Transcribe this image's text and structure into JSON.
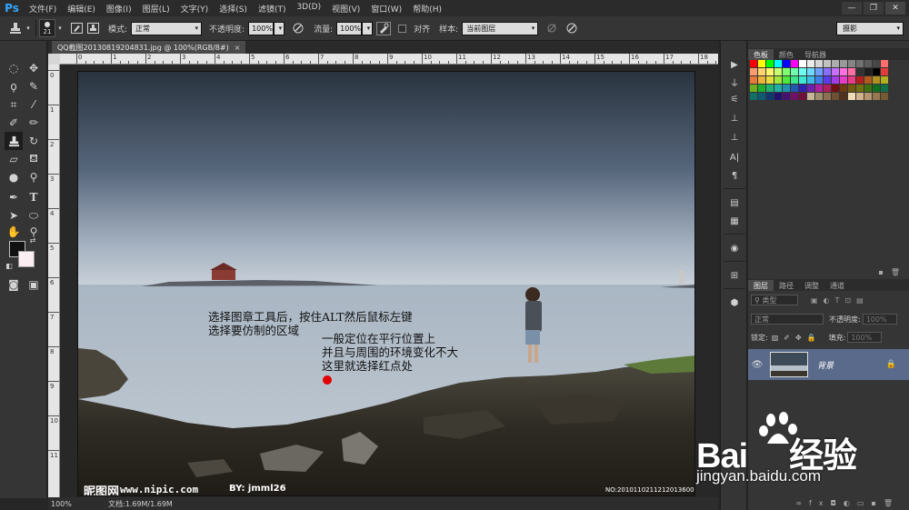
{
  "app": {
    "logo": "Ps"
  },
  "menu": [
    "文件(F)",
    "编辑(E)",
    "图像(I)",
    "图层(L)",
    "文字(Y)",
    "选择(S)",
    "滤镜(T)",
    "3D(D)",
    "视图(V)",
    "窗口(W)",
    "帮助(H)"
  ],
  "window_controls": {
    "minimize": "—",
    "restore": "❐",
    "close": "✕"
  },
  "options": {
    "brush_size": "21",
    "mode_label": "模式:",
    "mode_value": "正常",
    "opacity_label": "不透明度:",
    "opacity_value": "100%",
    "flow_label": "流量:",
    "flow_value": "100%",
    "align_label": "对齐",
    "sample_label": "样本:",
    "sample_value": "当前图层"
  },
  "workspace": {
    "value": "摄影"
  },
  "document": {
    "tab_title": "QQ截图20130819204831.jpg @ 100%(RGB/8#)",
    "tab_close": "×"
  },
  "rulers": {
    "top": [
      "0",
      "1",
      "2",
      "3",
      "4",
      "5",
      "6",
      "7",
      "8",
      "9",
      "10",
      "11",
      "12",
      "13",
      "14",
      "15",
      "16",
      "17",
      "18"
    ],
    "left": [
      "0",
      "1",
      "2",
      "3",
      "4",
      "5",
      "6",
      "7",
      "8",
      "9",
      "10",
      "11"
    ]
  },
  "canvas": {
    "note1_line1": "选择图章工具后，按住ALT然后鼠标左键",
    "note1_line2": "选择要仿制的区域",
    "note2_line1": "一般定位在平行位置上",
    "note2_line2": "并且与周围的环境变化不大",
    "note2_line3": "这里就选择红点处",
    "watermark_brand": "昵图网",
    "watermark_url": "www.nipic.com",
    "watermark_author": "BY: jmml26",
    "watermark_no": "NO:20101102112120136000",
    "dot_color": "#e00000"
  },
  "status": {
    "zoom": "100%",
    "doc_info": "文档:1.69M/1.69M"
  },
  "panels": {
    "swatches_tabs": [
      "色板",
      "颜色",
      "导航器"
    ],
    "layers_tabs": [
      "图层",
      "路径",
      "调整",
      "通道"
    ],
    "filter_type": "类型",
    "blend_mode": "正常",
    "opacity_label": "不透明度:",
    "opacity_value": "100%",
    "lock_label": "锁定:",
    "fill_label": "填充:",
    "fill_value": "100%",
    "layer_name": "背景"
  },
  "swatch_colors": [
    [
      "#ff0000",
      "#ffff00",
      "#00ff00",
      "#00ffff",
      "#0000ff",
      "#ff00ff",
      "#ffffff",
      "#ebebeb",
      "#d6d6d6",
      "#c2c2c2",
      "#adadad",
      "#999999",
      "#858585",
      "#707070",
      "#5c5c5c",
      "#474747",
      "#ff6f6f"
    ],
    [
      "#ff9b6f",
      "#ffd46f",
      "#fff56f",
      "#c6ff6f",
      "#7dff6f",
      "#6fffaa",
      "#6ffff0",
      "#6fd9ff",
      "#6f9fff",
      "#886fff",
      "#c86fff",
      "#ff6fe0",
      "#ff6fa5",
      "#333333",
      "#1f1f1f",
      "#000000",
      "#e03c3c"
    ],
    [
      "#e8783c",
      "#e8b43c",
      "#e8dc3c",
      "#a0e83c",
      "#50e83c",
      "#3ce88c",
      "#3ce8d4",
      "#3cbce8",
      "#3c80e8",
      "#5c3ce8",
      "#a43ce8",
      "#e83cc8",
      "#e83c84",
      "#b02020",
      "#b05a20",
      "#b09020",
      "#b0b020"
    ],
    [
      "#6cb020",
      "#20b030",
      "#20b070",
      "#20b0a4",
      "#2090b0",
      "#2058b0",
      "#3020b0",
      "#7020b0",
      "#b020a0",
      "#b02060",
      "#701010",
      "#703a10",
      "#705a10",
      "#707010",
      "#407010",
      "#107020",
      "#107048"
    ],
    [
      "#107068",
      "#105a70",
      "#103870",
      "#201070",
      "#481070",
      "#701068",
      "#70103c",
      "#c8b496",
      "#a08c6e",
      "#8c7050",
      "#6e5032",
      "#50321e",
      "#f0dcb4",
      "#d2b48c",
      "#b4966e",
      "#967850",
      "#785a32"
    ]
  ]
}
